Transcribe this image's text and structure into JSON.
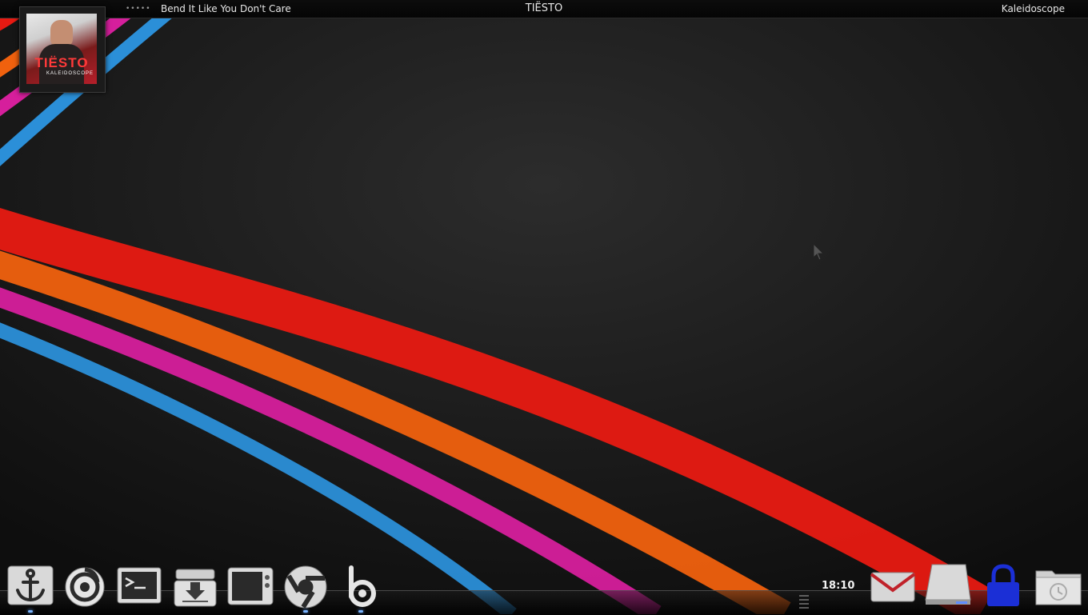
{
  "now_playing": {
    "progress_dots": "•••••",
    "song_title": "Bend It Like You Don't Care",
    "artist": "TIËSTO",
    "album": "Kaleidoscope",
    "cover_artist_text": "TIËSTO",
    "cover_album_text": "KALEIDOSCOPE"
  },
  "dock": {
    "launchers": [
      {
        "name": "anchor-icon"
      },
      {
        "name": "power-swirl-icon"
      },
      {
        "name": "terminal-icon"
      },
      {
        "name": "download-tray-icon"
      },
      {
        "name": "window-app-icon"
      },
      {
        "name": "chrome-icon"
      },
      {
        "name": "b-logo-icon"
      }
    ],
    "clock": "18:10",
    "tray": [
      {
        "name": "mail-icon"
      },
      {
        "name": "drive-icon"
      },
      {
        "name": "lock-icon"
      },
      {
        "name": "folder-clock-icon"
      }
    ]
  },
  "colors": {
    "stripe_red": "#e81a12",
    "stripe_orange": "#f0610e",
    "stripe_magenta": "#d61f9c",
    "stripe_blue": "#2b8fd8",
    "running_indicator": "#7ab4ff",
    "lock_blue": "#1b2fd6"
  }
}
